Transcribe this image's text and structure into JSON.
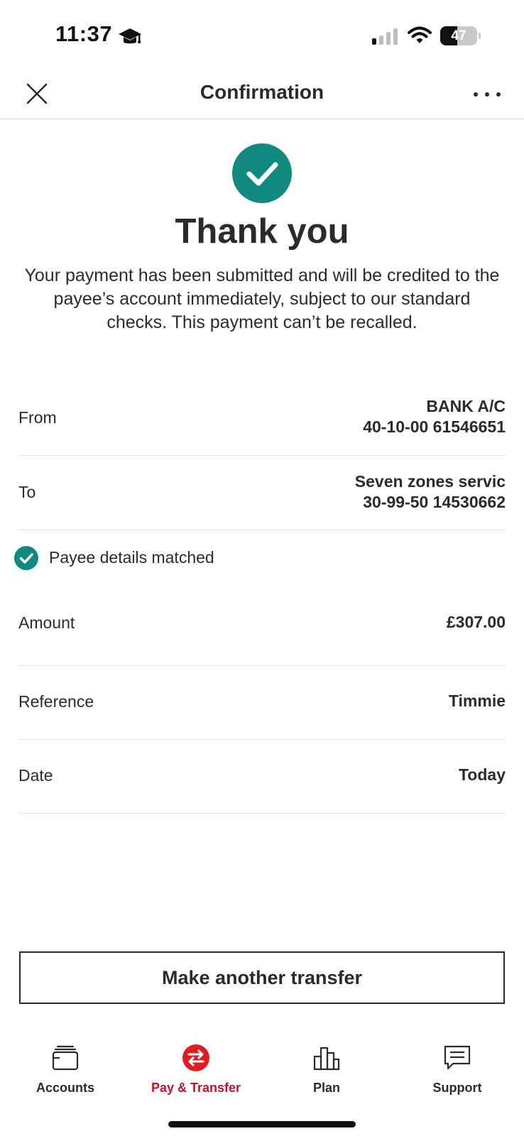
{
  "status_bar": {
    "time": "11:37",
    "battery_level": "47",
    "battery_fraction": 0.47
  },
  "header": {
    "title": "Confirmation",
    "close_icon": "close-icon",
    "more_icon": "more-options-icon"
  },
  "success": {
    "icon": "check-circle-icon",
    "title": "Thank you",
    "message": "Your payment has been submitted and will be credited to the payee’s account immediately, subject to our standard checks. This payment can’t be recalled."
  },
  "details": {
    "from": {
      "label": "From",
      "line1": "BANK A/C",
      "line2": "40-10-00 61546651"
    },
    "to": {
      "label": "To",
      "line1": "Seven zones servic",
      "line2": "30-99-50 14530662"
    },
    "matched": {
      "icon": "check-circle-icon",
      "label": "Payee details matched"
    },
    "amount": {
      "label": "Amount",
      "value": "£307.00"
    },
    "reference": {
      "label": "Reference",
      "value": "Timmie"
    },
    "date": {
      "label": "Date",
      "value": "Today"
    }
  },
  "actions": {
    "make_another_transfer": "Make another transfer"
  },
  "bottom_nav": {
    "items": [
      {
        "label": "Accounts",
        "icon": "wallet-icon",
        "active": false
      },
      {
        "label": "Pay & Transfer",
        "icon": "transfer-icon",
        "active": true
      },
      {
        "label": "Plan",
        "icon": "bar-chart-icon",
        "active": false
      },
      {
        "label": "Support",
        "icon": "chat-icon",
        "active": false
      }
    ]
  },
  "colors": {
    "teal": "#108a7e",
    "brand_red": "#e11b22",
    "text": "#2b2b2b",
    "divider": "#e2e2e2"
  }
}
